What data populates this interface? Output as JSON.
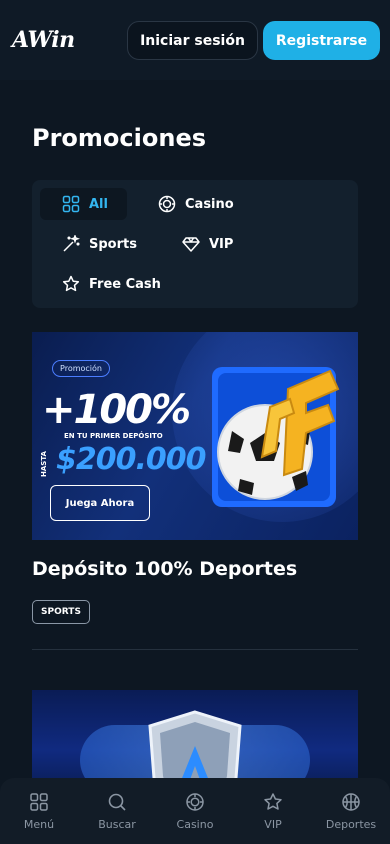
{
  "header": {
    "logo": "AWin",
    "login_label": "Iniciar sesión",
    "register_label": "Registrarse"
  },
  "page": {
    "title": "Promociones"
  },
  "filters": [
    {
      "label": "All",
      "icon": "grid-icon",
      "active": true
    },
    {
      "label": "Casino",
      "icon": "chip-icon",
      "active": false
    },
    {
      "label": "Sports",
      "icon": "magic-wand-icon",
      "active": false
    },
    {
      "label": "VIP",
      "icon": "diamond-icon",
      "active": false
    },
    {
      "label": "Free Cash",
      "icon": "star-icon",
      "active": false
    }
  ],
  "promo": {
    "banner": {
      "pill": "Promoción",
      "headline": "+100%",
      "subline": "EN TU PRIMER DEPÓSITO",
      "hasta": "HASTA",
      "amount": "$200.000",
      "cta": "Juega Ahora"
    },
    "title": "Depósito 100% Deportes",
    "tag": "SPORTS"
  },
  "bottom_nav": [
    {
      "label": "Menú",
      "icon": "grid-icon"
    },
    {
      "label": "Buscar",
      "icon": "search-icon"
    },
    {
      "label": "Casino",
      "icon": "chip-icon"
    },
    {
      "label": "VIP",
      "icon": "star-icon"
    },
    {
      "label": "Deportes",
      "icon": "basketball-icon"
    }
  ],
  "colors": {
    "accent": "#1fb0e6",
    "background": "#0d1722",
    "active_filter": "#33b6f0"
  }
}
